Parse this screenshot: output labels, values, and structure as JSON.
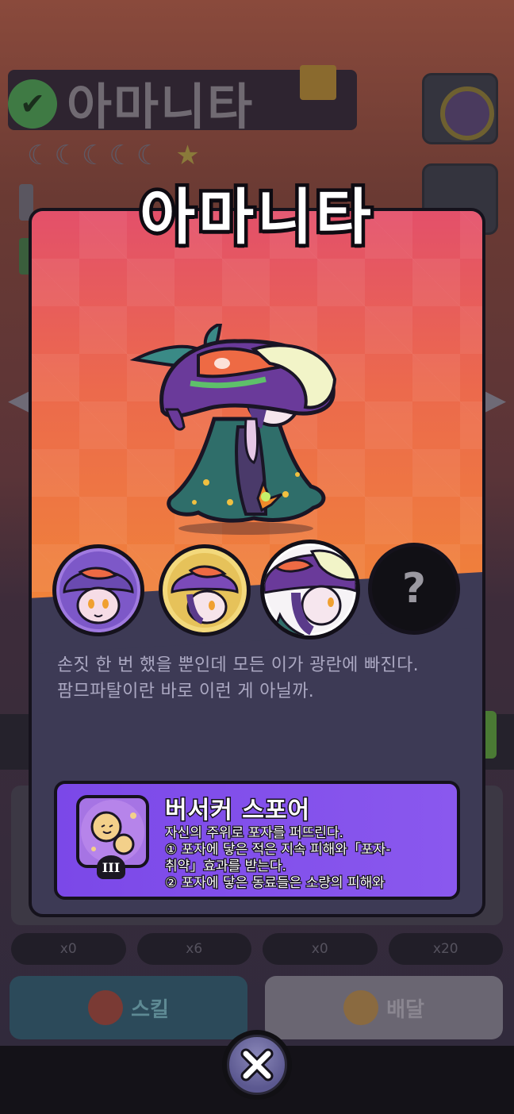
{
  "background": {
    "character_name": "아마니타",
    "moons": "☾☾☾☾☾",
    "star": "★",
    "check_icon": "✔",
    "pills": [
      "x0",
      "x6",
      "x0",
      "x20"
    ],
    "skill_button_label": "스킬",
    "equip_button_label": "배달"
  },
  "modal": {
    "title": "아마니타",
    "skins": [
      {
        "name": "skin-1",
        "selected": false
      },
      {
        "name": "skin-2",
        "selected": false
      },
      {
        "name": "skin-3",
        "selected": true
      },
      {
        "name": "skin-locked",
        "locked_glyph": "?"
      }
    ],
    "description": [
      "손짓 한 번 했을 뿐인데 모든 이가 광란에 빠진다.",
      "팜므파탈이란 바로 이런 게 아닐까."
    ],
    "skill": {
      "name": "버서커 스포어",
      "level": "III",
      "desc_lines": [
        "자신의 주위로 포자를 퍼뜨린다.",
        "① 포자에 닿은 적은 지속 피해와「포자-",
        "취약」효과를 받는다.",
        "② 포자에 닿은 동료들은 소량의 피해와"
      ]
    }
  },
  "colors": {
    "card_top_gradient": [
      "#e3506a",
      "#ec6a4c",
      "#f08438"
    ],
    "card_bottom": "#3d3a55",
    "skill_box": "#7b48e8",
    "close_button": "#6e6ba4"
  },
  "icons": {
    "close": "close-icon",
    "locked_skin": "question-mark-icon"
  }
}
